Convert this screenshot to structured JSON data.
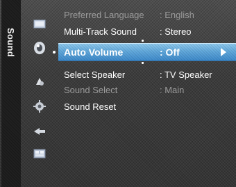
{
  "tab": {
    "title": "Sound"
  },
  "icons": [
    "picture-icon",
    "sound-icon",
    "channel-icon",
    "setup-icon",
    "input-icon",
    "application-icon"
  ],
  "menu": {
    "items": [
      {
        "label": "Preferred Language",
        "value": ": English",
        "state": "dim"
      },
      {
        "label": "Multi-Track Sound",
        "value": ": Stereo",
        "state": "normal"
      },
      {
        "label": "Auto Volume",
        "value": ": Off",
        "state": "selected"
      },
      {
        "label": "Select Speaker",
        "value": ": TV Speaker",
        "state": "normal"
      },
      {
        "label": "Sound Select",
        "value": ": Main",
        "state": "dim"
      },
      {
        "label": "Sound Reset",
        "value": "",
        "state": "normal"
      }
    ]
  },
  "colors": {
    "highlight": "#5ba4d9",
    "text": "#ffffff",
    "dim_text": "#9b9b9b"
  }
}
